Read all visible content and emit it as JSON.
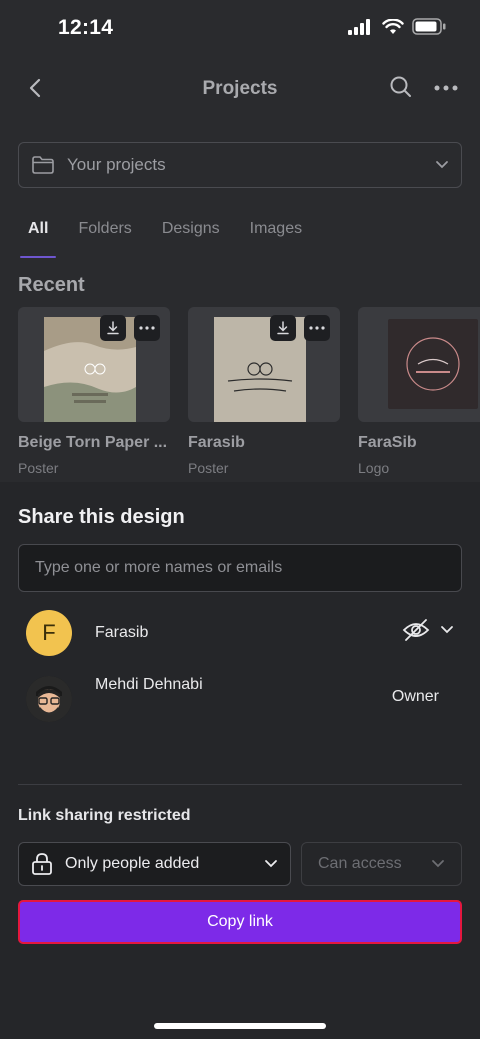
{
  "status_bar": {
    "time": "12:14"
  },
  "header": {
    "title": "Projects"
  },
  "folder_select": {
    "label": "Your projects"
  },
  "tabs": [
    {
      "label": "All",
      "active": true
    },
    {
      "label": "Folders",
      "active": false
    },
    {
      "label": "Designs",
      "active": false
    },
    {
      "label": "Images",
      "active": false
    }
  ],
  "recent": {
    "title": "Recent",
    "items": [
      {
        "name": "Beige Torn Paper ...",
        "type": "Poster"
      },
      {
        "name": "Farasib",
        "type": "Poster"
      },
      {
        "name": "FaraSib",
        "type": "Logo"
      }
    ]
  },
  "share_sheet": {
    "title": "Share this design",
    "input_placeholder": "Type one or more names or emails",
    "people": [
      {
        "initial": "F",
        "name": "Farasib",
        "avatar_color": "#f2c34f"
      },
      {
        "name": "Mehdi Dehnabi",
        "role": "Owner"
      }
    ],
    "link_label": "Link sharing restricted",
    "restriction_value": "Only people added",
    "access_value": "Can access",
    "copy_button": "Copy link"
  },
  "colors": {
    "accent": "#7d2ae8",
    "highlight_border": "#e5173f",
    "tab_indicator": "#6e56cf"
  }
}
